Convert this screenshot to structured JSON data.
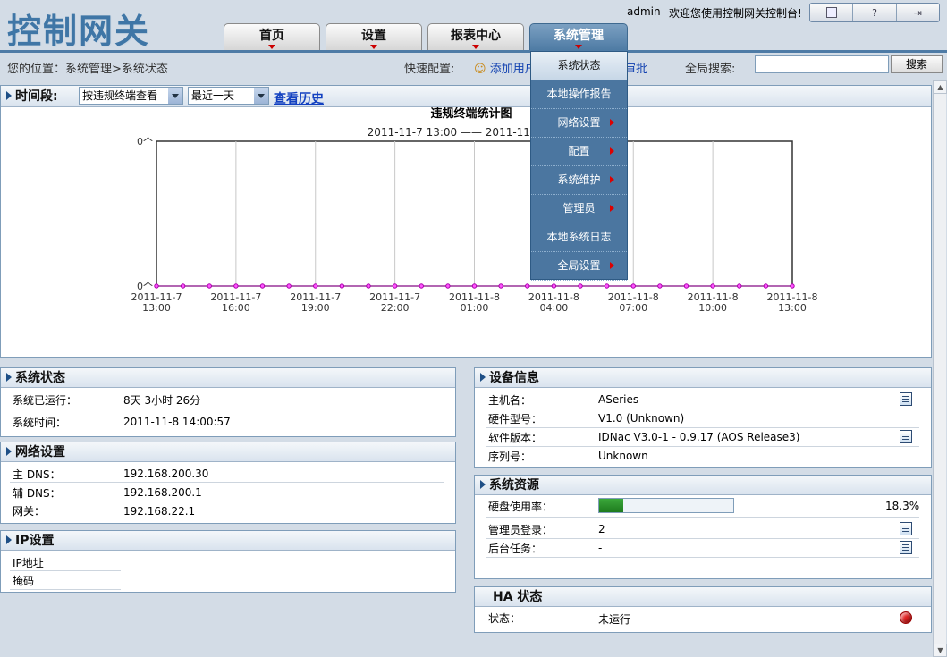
{
  "header": {
    "logo": "控制网关",
    "admin": "admin",
    "welcome": "欢迎您使用控制网关控制台!"
  },
  "nav": {
    "tabs": [
      {
        "label": "首页"
      },
      {
        "label": "设置"
      },
      {
        "label": "报表中心"
      },
      {
        "label": "系统管理"
      }
    ]
  },
  "breadcrumb": {
    "text": "您的位置：系统管理>系统状态"
  },
  "quick": {
    "label": "快速配置:",
    "add_user": "添加用户",
    "audit": "审批"
  },
  "search": {
    "label": "全局搜索:",
    "value": "",
    "button": "搜索"
  },
  "menu": {
    "items": [
      {
        "label": "系统状态",
        "submenu": false
      },
      {
        "label": "本地操作报告",
        "submenu": false
      },
      {
        "label": "网络设置",
        "submenu": true
      },
      {
        "label": "配置",
        "submenu": true
      },
      {
        "label": "系统维护",
        "submenu": true
      },
      {
        "label": "管理员",
        "submenu": true
      },
      {
        "label": "本地系统日志",
        "submenu": false
      },
      {
        "label": "全局设置",
        "submenu": true
      }
    ]
  },
  "filter": {
    "label": "时间段:",
    "mode": "按违规终端查看",
    "range": "最近一天",
    "history": "查看历史"
  },
  "chart_data": {
    "type": "line",
    "title": "违规终端统计图",
    "subtitle": "2011-11-7 13:00 —— 2011-11-8 13:00",
    "y_ticks": [
      "0个",
      "0个"
    ],
    "x_labels": [
      [
        "2011-11-7",
        "13:00"
      ],
      [
        "2011-11-7",
        "16:00"
      ],
      [
        "2011-11-7",
        "19:00"
      ],
      [
        "2011-11-7",
        "22:00"
      ],
      [
        "2011-11-8",
        "01:00"
      ],
      [
        "2011-11-8",
        "04:00"
      ],
      [
        "2011-11-8",
        "07:00"
      ],
      [
        "2011-11-8",
        "10:00"
      ],
      [
        "2011-11-8",
        "13:00"
      ]
    ],
    "values": [
      0,
      0,
      0,
      0,
      0,
      0,
      0,
      0,
      0,
      0,
      0,
      0,
      0,
      0,
      0,
      0,
      0,
      0,
      0,
      0,
      0,
      0,
      0,
      0,
      0
    ],
    "ylim": [
      0,
      0
    ]
  },
  "status": {
    "title": "系统状态",
    "rows": [
      {
        "k": "系统已运行：",
        "v": "8天 3小时 26分"
      },
      {
        "k": "系统时间：",
        "v": "2011-11-8 14:00:57"
      }
    ]
  },
  "network": {
    "title": "网络设置",
    "rows": [
      {
        "k": "主 DNS：",
        "v": "192.168.200.30"
      },
      {
        "k": "辅 DNS：",
        "v": "192.168.200.1"
      },
      {
        "k": "网关：",
        "v": "192.168.22.1"
      }
    ]
  },
  "ip": {
    "title": "IP设置",
    "rows": [
      {
        "k": "IP地址"
      },
      {
        "k": "掩码"
      }
    ]
  },
  "device": {
    "title": "设备信息",
    "rows": [
      {
        "k": "主机名：",
        "v": "ASeries"
      },
      {
        "k": "硬件型号：",
        "v": "V1.0 (Unknown)"
      },
      {
        "k": "软件版本：",
        "v": "IDNac V3.0-1 - 0.9.17 (AOS Release3)"
      },
      {
        "k": "序列号：",
        "v": "Unknown"
      }
    ]
  },
  "resource": {
    "title": "系统资源",
    "disk_label": "硬盘使用率：",
    "disk_pct": "18.3%",
    "disk_fill": 0.183,
    "admin_label": "管理员登录：",
    "admin_v": "2",
    "task_label": "后台任务：",
    "task_v": "-"
  },
  "ha": {
    "title": "HA 状态",
    "k": "状态：",
    "v": "未运行",
    "status_color": "#e02020"
  }
}
